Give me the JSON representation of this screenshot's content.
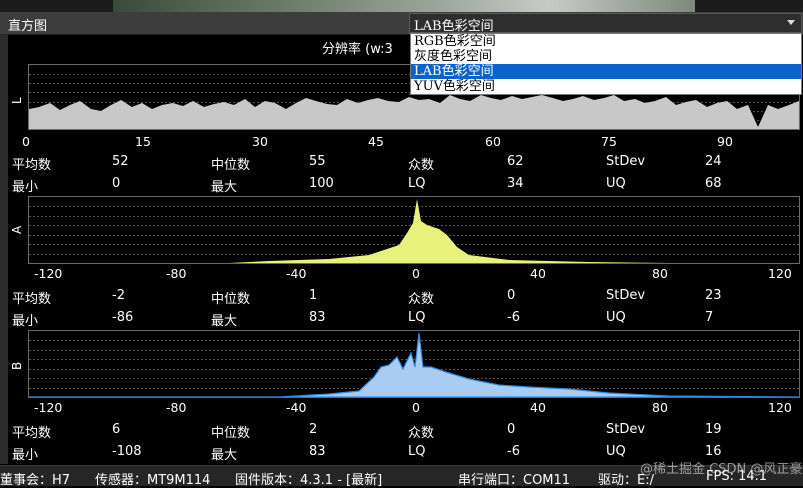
{
  "window": {
    "title": "直方图"
  },
  "colorspace": {
    "selected": "LAB色彩空间",
    "options": [
      "RGB色彩空间",
      "灰度色彩空间",
      "LAB色彩空间",
      "YUV色彩空间"
    ],
    "selected_index": 2
  },
  "resolution_label": "分辨率 (w:3",
  "channels": {
    "L": {
      "label": "L",
      "ticks": [
        "0",
        "15",
        "30",
        "45",
        "60",
        "75",
        "90"
      ],
      "stats_row1": [
        "平均数",
        "52",
        "中位数",
        "55",
        "众数",
        "62",
        "StDev",
        "24"
      ],
      "stats_row2": [
        "最小",
        "0",
        "最大",
        "100",
        "LQ",
        "34",
        "UQ",
        "68"
      ]
    },
    "A": {
      "label": "A",
      "ticks": [
        "-120",
        "-80",
        "-40",
        "0",
        "40",
        "80",
        "120"
      ],
      "stats_row1": [
        "平均数",
        "-2",
        "中位数",
        "1",
        "众数",
        "0",
        "StDev",
        "23"
      ],
      "stats_row2": [
        "最小",
        "-86",
        "最大",
        "83",
        "LQ",
        "-6",
        "UQ",
        "7"
      ]
    },
    "B": {
      "label": "B",
      "ticks": [
        "-120",
        "-80",
        "-40",
        "0",
        "40",
        "80",
        "120"
      ],
      "stats_row1": [
        "平均数",
        "6",
        "中位数",
        "2",
        "众数",
        "0",
        "StDev",
        "19"
      ],
      "stats_row2": [
        "最小",
        "-108",
        "最大",
        "83",
        "LQ",
        "-6",
        "UQ",
        "16"
      ]
    }
  },
  "colors": {
    "L_fill": "#c8c8c8",
    "A_fill": "#e8f27a",
    "B_fill": "#a9cdf2",
    "B_line": "#2d8ae0",
    "selection": "#0a63cc"
  },
  "statusbar": {
    "board": "董事会：H7",
    "sensor": "传感器：MT9M114",
    "firmware": "固件版本：4.3.1 - [最新]",
    "port": "串行端口：COM11",
    "drive": "驱动：E:/",
    "fps": "FPS:  14.1"
  },
  "watermark": "@稀土掘金 CSDN @风正豪"
}
